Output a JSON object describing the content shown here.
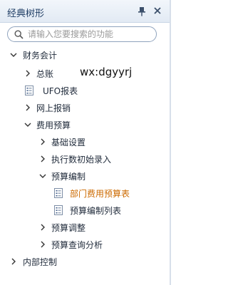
{
  "panel": {
    "title": "经典树形"
  },
  "search": {
    "placeholder": "请输入您要搜索的功能"
  },
  "tree": {
    "items": [
      {
        "label": "财务会计",
        "type": "folder",
        "state": "expanded"
      },
      {
        "label": "总账",
        "type": "folder",
        "state": "collapsed"
      },
      {
        "label": "UFO报表",
        "type": "leaf"
      },
      {
        "label": "网上报销",
        "type": "folder",
        "state": "collapsed"
      },
      {
        "label": "费用预算",
        "type": "folder",
        "state": "expanded"
      },
      {
        "label": "基础设置",
        "type": "folder",
        "state": "collapsed"
      },
      {
        "label": "执行数初始录入",
        "type": "folder",
        "state": "collapsed"
      },
      {
        "label": "预算编制",
        "type": "folder",
        "state": "expanded"
      },
      {
        "label": "部门费用预算表",
        "type": "leaf",
        "selected": true
      },
      {
        "label": "预算编制列表",
        "type": "leaf"
      },
      {
        "label": "预算调整",
        "type": "folder",
        "state": "collapsed"
      },
      {
        "label": "预算查询分析",
        "type": "folder",
        "state": "collapsed"
      },
      {
        "label": "内部控制",
        "type": "folder",
        "state": "collapsed"
      }
    ]
  },
  "watermark": {
    "text": "wx:dgyyrj"
  },
  "colors": {
    "selected_text": "#cc6a00",
    "titlebar_text": "#1e3c64",
    "search_border": "#8fa3bd"
  }
}
